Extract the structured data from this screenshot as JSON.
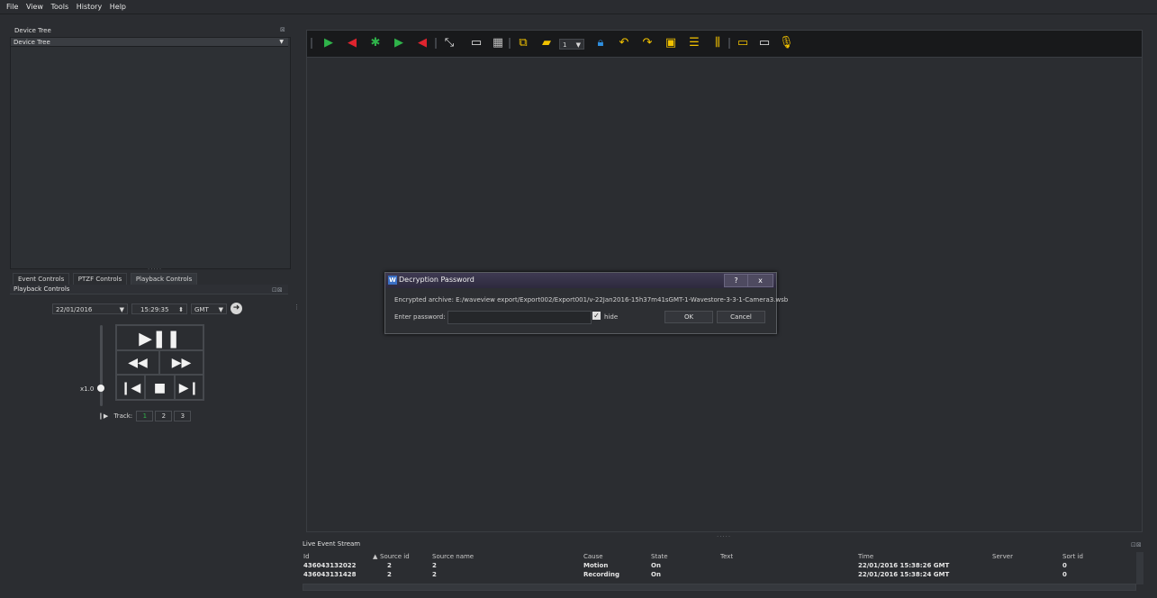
{
  "menu": [
    "File",
    "View",
    "Tools",
    "History",
    "Help"
  ],
  "device_tree": {
    "title": "Device Tree",
    "selected": "Device Tree"
  },
  "tabs": [
    "Event Controls",
    "PTZF Controls",
    "Playback Controls"
  ],
  "playback": {
    "title": "Playback Controls",
    "date": "22/01/2016",
    "time": "15:29:35",
    "timezone": "GMT",
    "speed": "x1.0",
    "track_label": "Track:",
    "tracks": [
      "1",
      "2",
      "3"
    ]
  },
  "toolbar": {
    "monitor_value": "1"
  },
  "dialog": {
    "title": "Decryption Password",
    "help": "?",
    "close": "x",
    "archive_text": "Encrypted archive: E:/waveview export/Export002/Export001/v-22Jan2016-15h37m41sGMT-1-Wavestore-3-3-1-Camera3.wsb",
    "password_label": "Enter password:",
    "password_value": "",
    "hide_label": "hide",
    "hide_checked": true,
    "ok": "OK",
    "cancel": "Cancel"
  },
  "live_event_stream": {
    "title": "Live Event Stream",
    "columns": [
      "Id",
      "Source id",
      "Source name",
      "Cause",
      "State",
      "Text",
      "Time",
      "Server",
      "Sort id"
    ],
    "rows": [
      [
        "436043132022",
        "2",
        "2",
        "Motion",
        "On",
        "",
        "22/01/2016 15:38:26 GMT",
        "",
        "0"
      ],
      [
        "436043131428",
        "2",
        "2",
        "Recording",
        "On",
        "",
        "22/01/2016 15:38:24 GMT",
        "",
        "0"
      ]
    ]
  },
  "colors": {
    "background": "#2b2d31",
    "toolbar": "#18191b",
    "accent_green": "#2fb34a",
    "accent_red": "#e0242e",
    "accent_yellow": "#f2c200",
    "accent_blue": "#2e8fe0"
  }
}
